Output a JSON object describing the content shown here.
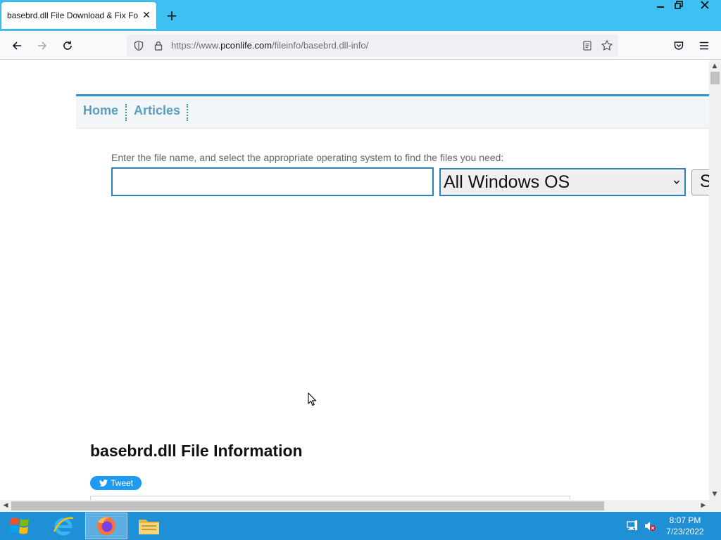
{
  "browser": {
    "tab_title": "basebrd.dll File Download & Fix For",
    "url_prefix": "https://www.",
    "url_domain": "pconlife.com",
    "url_path": "/fileinfo/basebrd.dll-info/"
  },
  "site_nav": {
    "items": [
      {
        "label": "Home"
      },
      {
        "label": "Articles"
      }
    ]
  },
  "search": {
    "hint": "Enter the file name, and select the appropriate operating system to find the files you need:",
    "input_value": "",
    "os_selected": "All Windows OS",
    "button_label": "S"
  },
  "content": {
    "section_title": "basebrd.dll File Information",
    "tweet_label": "Tweet"
  },
  "taskbar": {
    "time": "8:07 PM",
    "date": "7/23/2022"
  },
  "colors": {
    "titlebar": "#3fc0f3",
    "accent": "#2a83b9",
    "nav_link": "#5b9fc0",
    "taskbar": "#1f8fd6"
  }
}
